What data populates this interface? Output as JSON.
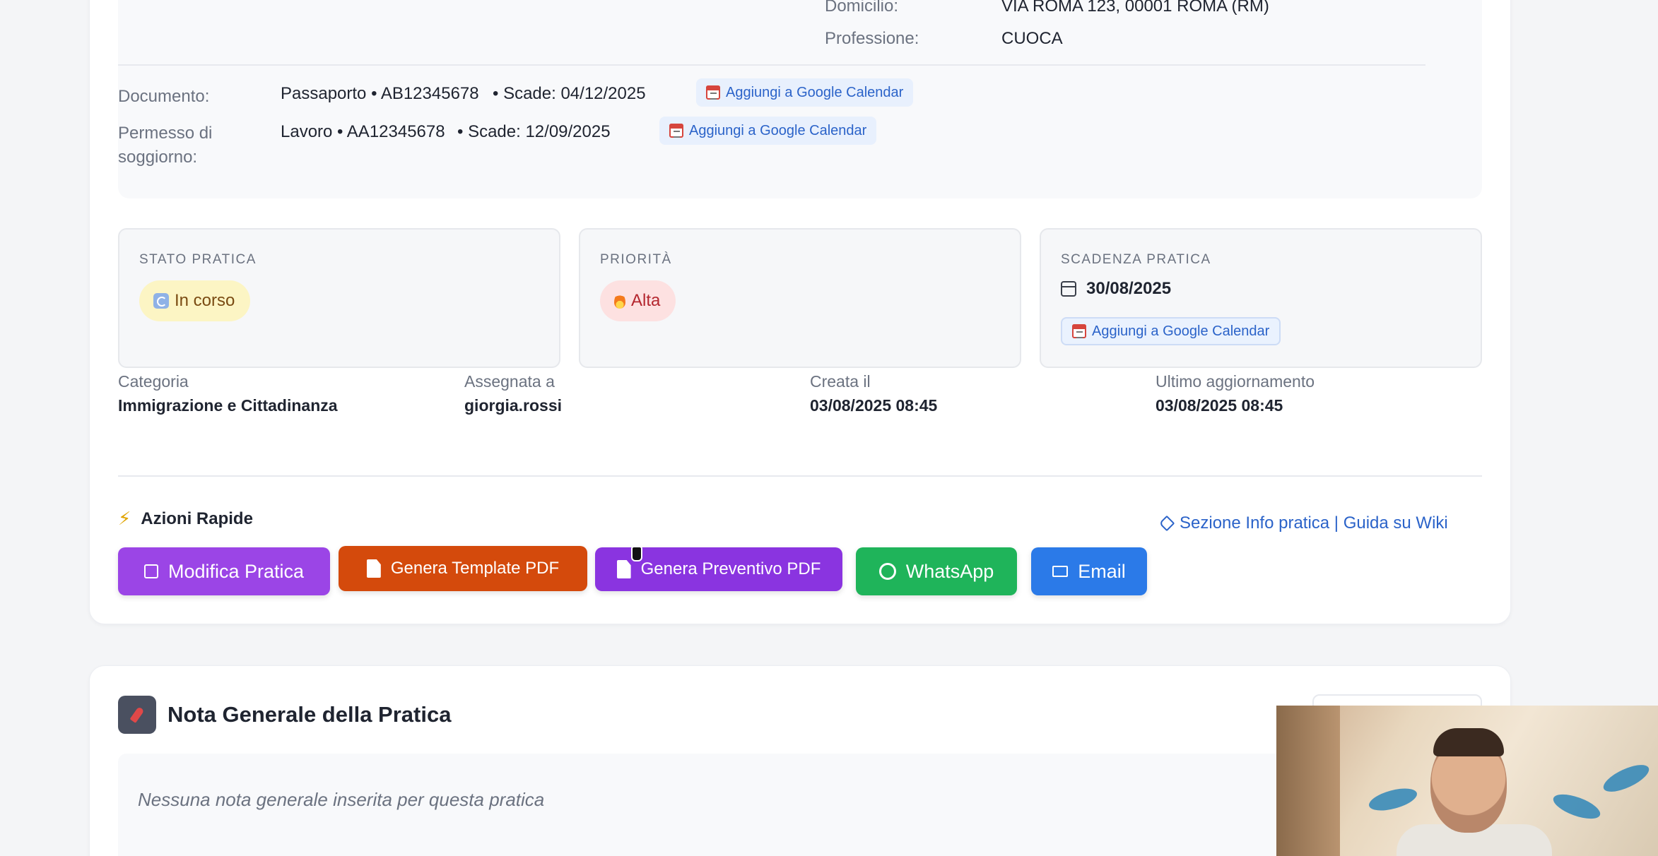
{
  "anagrafica": {
    "domicilio_label": "Domicilio:",
    "domicilio_value": "VIA ROMA 123, 00001 ROMA (RM)",
    "professione_label": "Professione:",
    "professione_value": "CUOCA",
    "documento_label": "Documento:",
    "documento_value": "Passaporto • AB12345678",
    "documento_scadenza": "• Scade: 04/12/2025",
    "permesso_label_1": "Permesso di",
    "permesso_label_2": "soggiorno:",
    "permesso_value": "Lavoro • AA12345678",
    "permesso_scadenza": "• Scade: 12/09/2025",
    "gcal_label": "Aggiungi a Google Calendar"
  },
  "stato": {
    "title": "STATO PRATICA",
    "value": "In corso",
    "color": "#fcf5c4"
  },
  "priorita": {
    "title": "PRIORITÀ",
    "value": "Alta",
    "color": "#fde1e1"
  },
  "scadenza": {
    "title": "SCADENZA PRATICA",
    "value": "30/08/2025",
    "gcal_label": "Aggiungi a Google Calendar"
  },
  "meta": {
    "categoria_label": "Categoria",
    "categoria_value": "Immigrazione e Cittadinanza",
    "assegnata_label": "Assegnata a",
    "assegnata_value": "giorgia.rossi",
    "creata_label": "Creata il",
    "creata_value": "03/08/2025 08:45",
    "aggiornamento_label": "Ultimo aggiornamento",
    "aggiornamento_value": "03/08/2025 08:45"
  },
  "azioni": {
    "title": "Azioni Rapide",
    "modifica": "Modifica Pratica",
    "template_pdf": "Genera Template PDF",
    "preventivo_pdf": "Genera Preventivo PDF",
    "whatsapp": "WhatsApp",
    "email": "Email",
    "wiki_link": "Sezione Info pratica | Guida su Wiki",
    "colors": {
      "modifica": "#9b45e6",
      "template_pdf": "#d44a0c",
      "preventivo_pdf": "#8a34e0",
      "whatsapp": "#1fb45a",
      "email": "#2b7ae8"
    }
  },
  "nota": {
    "title": "Nota Generale della Pratica",
    "empty_text": "Nessuna nota generale inserita per questa pratica"
  }
}
